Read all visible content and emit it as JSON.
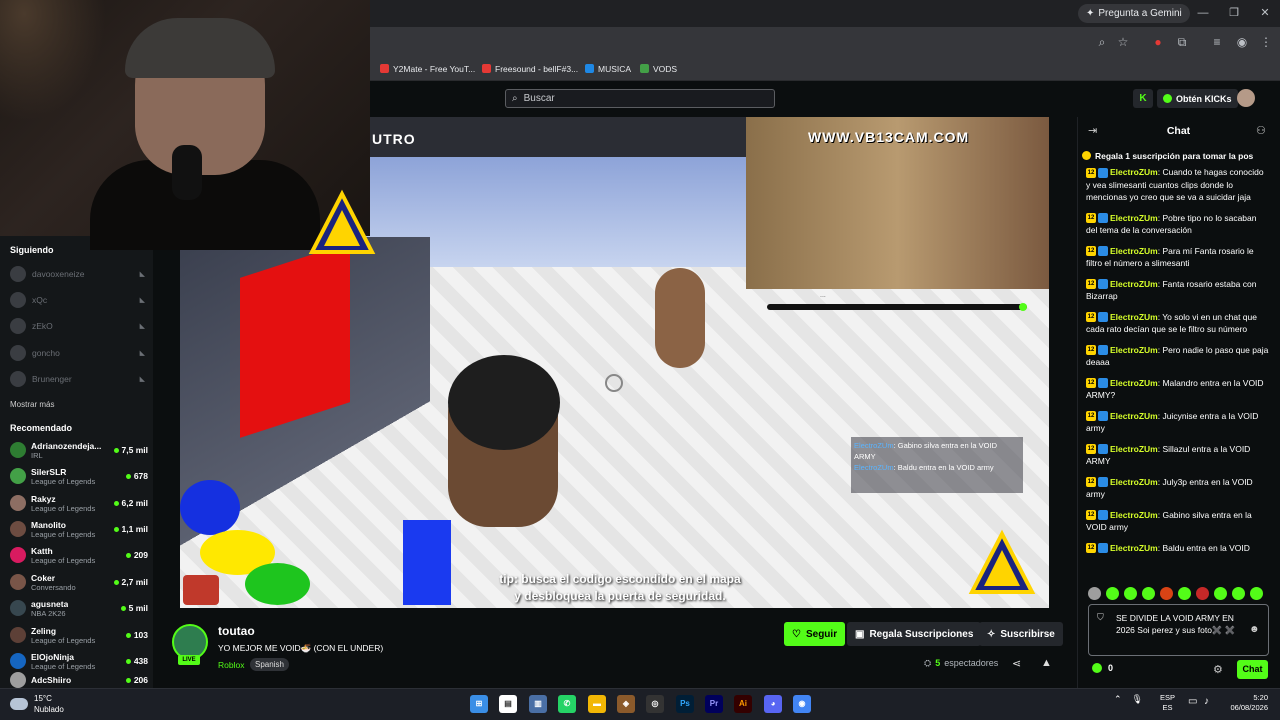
{
  "browser": {
    "gemini_label": "Pregunta a Gemini",
    "bookmarks": [
      {
        "label": "Y2Mate - Free YouT...",
        "color": "#e53935"
      },
      {
        "label": "Freesound - bellF#3...",
        "color": "#e53935"
      },
      {
        "label": "MUSICA",
        "color": "#1e88e5"
      },
      {
        "label": "VODS",
        "color": "#43a047"
      }
    ]
  },
  "header": {
    "search_placeholder": "Buscar",
    "kick_logo": "K",
    "get_kicks_label": "Obtén KICKs"
  },
  "sidebar": {
    "following_title": "Siguiendo",
    "following": [
      "davooxeneize",
      "xQc",
      "zEkO",
      "goncho",
      "Brunenger"
    ],
    "show_more": "Mostrar más",
    "recommended_title": "Recomendado",
    "recommended": [
      {
        "name": "Adrianozendeja...",
        "category": "IRL",
        "viewers": "7,5 mil",
        "color": "#2e7d32"
      },
      {
        "name": "SilerSLR",
        "category": "League of Legends",
        "viewers": "678",
        "color": "#43a047"
      },
      {
        "name": "Rakyz",
        "category": "League of Legends",
        "viewers": "6,2 mil",
        "color": "#8d6e63"
      },
      {
        "name": "Manolito",
        "category": "League of Legends",
        "viewers": "1,1 mil",
        "color": "#6d4c41"
      },
      {
        "name": "Katth",
        "category": "League of Legends",
        "viewers": "209",
        "color": "#d81b60"
      },
      {
        "name": "Coker",
        "category": "Conversando",
        "viewers": "2,7 mil",
        "color": "#795548"
      },
      {
        "name": "agusneta",
        "category": "NBA 2K26",
        "viewers": "5 mil",
        "color": "#37474f"
      },
      {
        "name": "Zeling",
        "category": "League of Legends",
        "viewers": "103",
        "color": "#5d4037"
      },
      {
        "name": "ElOjoNinja",
        "category": "League of Legends",
        "viewers": "438",
        "color": "#1565c0"
      },
      {
        "name": "AdcShiiro",
        "category": "",
        "viewers": "206",
        "color": "#9e9e9e"
      }
    ]
  },
  "video": {
    "game_title": "UTRO",
    "inset_watermark": "WWW.VB13CAM.COM",
    "inset_caption": "...",
    "overlay_chat": [
      {
        "user": "ElectroZUm",
        "text": ": Gabino silva entra en la VOID ARMY"
      },
      {
        "user": "ElectroZUm",
        "text": ": Baldu entra en la VOID army"
      }
    ],
    "subtitle_line1": "tip: busca el codigo escondido en el mapa",
    "subtitle_line2": "y desbloquea la puerta de seguridad."
  },
  "stream": {
    "streamer": "toutao",
    "live": "LIVE",
    "title": "YO MEJOR ME VOID🍜 (CON EL UNDER)",
    "category": "Roblox",
    "tag": "Spanish",
    "follow_label": "Seguir",
    "gift_label": "Regala Suscripciones",
    "subscribe_label": "Suscribirse",
    "viewers_count": "5",
    "viewers_label": "espectadores"
  },
  "chat": {
    "title": "Chat",
    "pinned": "Regala 1 suscripción para tomar la pos",
    "messages": [
      {
        "user": "ElectroZUm",
        "text": "Cuando te hagas conocido y vea slimesanti cuantos clips donde lo mencionas yo creo que se va a suicidar jaja"
      },
      {
        "user": "ElectroZUm",
        "text": "Pobre tipo no lo sacaban del tema de la conversación"
      },
      {
        "user": "ElectroZUm",
        "text": "Para mí Fanta rosario le filtro el número a slimesanti"
      },
      {
        "user": "ElectroZUm",
        "text": "Fanta rosario estaba con Bizarrap"
      },
      {
        "user": "ElectroZUm",
        "text": "Yo solo vi en un chat que cada rato decían que se le filtro su número"
      },
      {
        "user": "ElectroZUm",
        "text": "Pero nadie lo paso que paja deaaa"
      },
      {
        "user": "ElectroZUm",
        "text": "Malandro entra en la VOID ARMY?"
      },
      {
        "user": "ElectroZUm",
        "text": "Juicynise entra a la VOID army"
      },
      {
        "user": "ElectroZUm",
        "text": "Sillazul entra a la VOID ARMY"
      },
      {
        "user": "ElectroZUm",
        "text": "July3p entra en la VOID army"
      },
      {
        "user": "ElectroZUm",
        "text": "Gabino silva entra en la VOID army"
      },
      {
        "user": "ElectroZUm",
        "text": "Baldu entra en la VOID"
      }
    ],
    "badge_number": "12",
    "input_value": "SE DIVIDE LA VOID ARMY EN 2026 Soi perez y sus foto✖️ ✖️",
    "kicks_count": "0",
    "send_label": "Chat"
  },
  "taskbar": {
    "temperature": "15°C",
    "weather": "Nublado",
    "lang_top": "ESP",
    "lang_bottom": "ES",
    "time": "5:20",
    "date": "06/08/2026"
  }
}
